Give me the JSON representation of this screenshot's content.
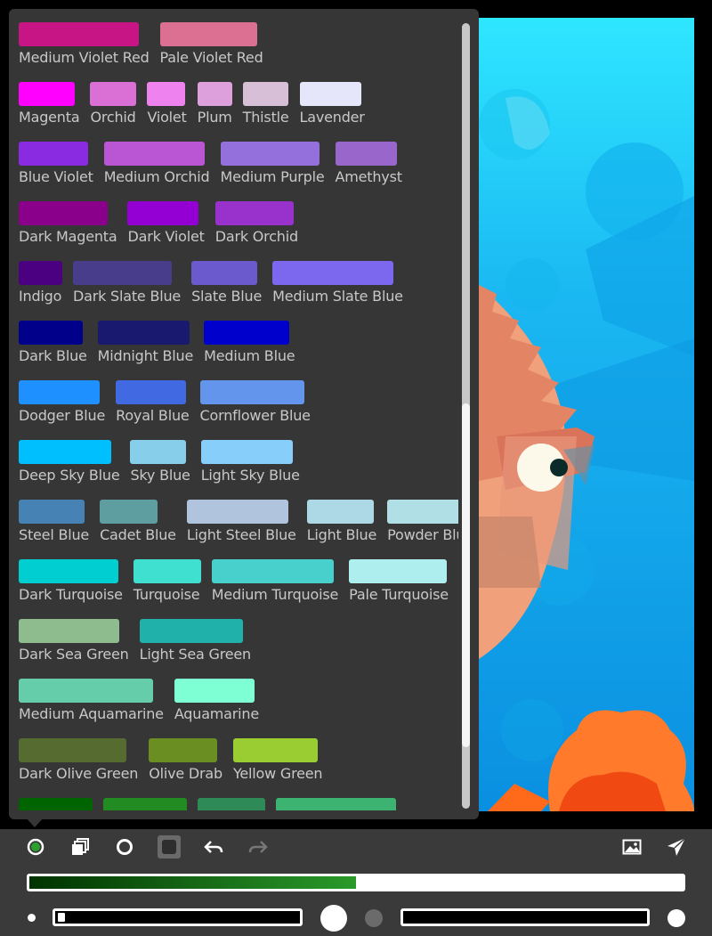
{
  "swatch_rows": [
    [
      {
        "label": "Medium Violet Red",
        "color": "#c71585"
      },
      {
        "label": "Pale Violet Red",
        "color": "#db7093"
      }
    ],
    [
      {
        "label": "Magenta",
        "color": "#ff00ff"
      },
      {
        "label": "Orchid",
        "color": "#da70d6"
      },
      {
        "label": "Violet",
        "color": "#ee82ee"
      },
      {
        "label": "Plum",
        "color": "#dda0dd"
      },
      {
        "label": "Thistle",
        "color": "#d8bfd8"
      },
      {
        "label": "Lavender",
        "color": "#e6e6fa"
      }
    ],
    [
      {
        "label": "Blue Violet",
        "color": "#8a2be2"
      },
      {
        "label": "Medium Orchid",
        "color": "#ba55d3"
      },
      {
        "label": "Medium Purple",
        "color": "#9370db"
      },
      {
        "label": "Amethyst",
        "color": "#9966cc"
      }
    ],
    [
      {
        "label": "Dark Magenta",
        "color": "#8b008b"
      },
      {
        "label": "Dark Violet",
        "color": "#9400d3"
      },
      {
        "label": "Dark Orchid",
        "color": "#9932cc"
      }
    ],
    [
      {
        "label": "Indigo",
        "color": "#4b0082"
      },
      {
        "label": "Dark Slate Blue",
        "color": "#483d8b"
      },
      {
        "label": "Slate Blue",
        "color": "#6a5acd"
      },
      {
        "label": "Medium Slate Blue",
        "color": "#7b68ee"
      }
    ],
    [
      {
        "label": "Dark Blue",
        "color": "#00008b"
      },
      {
        "label": "Midnight Blue",
        "color": "#191970"
      },
      {
        "label": "Medium Blue",
        "color": "#0000cd"
      }
    ],
    [
      {
        "label": "Dodger Blue",
        "color": "#1e90ff"
      },
      {
        "label": "Royal Blue",
        "color": "#4169e1"
      },
      {
        "label": "Cornflower Blue",
        "color": "#6495ed"
      }
    ],
    [
      {
        "label": "Deep Sky Blue",
        "color": "#00bfff"
      },
      {
        "label": "Sky Blue",
        "color": "#87ceeb"
      },
      {
        "label": "Light Sky Blue",
        "color": "#87cefa"
      }
    ],
    [
      {
        "label": "Steel Blue",
        "color": "#4682b4"
      },
      {
        "label": "Cadet Blue",
        "color": "#5f9ea0"
      },
      {
        "label": "Light Steel Blue",
        "color": "#b0c4de"
      },
      {
        "label": "Light Blue",
        "color": "#add8e6"
      },
      {
        "label": "Powder Blue",
        "color": "#b0e0e6"
      }
    ],
    [
      {
        "label": "Dark Turquoise",
        "color": "#00ced1"
      },
      {
        "label": "Turquoise",
        "color": "#40e0d0"
      },
      {
        "label": "Medium Turquoise",
        "color": "#48d1cc"
      },
      {
        "label": "Pale Turquoise",
        "color": "#afeeee"
      }
    ],
    [
      {
        "label": "Dark Sea Green",
        "color": "#8fbc8f"
      },
      {
        "label": "Light Sea Green",
        "color": "#20b2aa"
      }
    ],
    [
      {
        "label": "Medium Aquamarine",
        "color": "#66cdaa"
      },
      {
        "label": "Aquamarine",
        "color": "#7fffd4"
      }
    ],
    [
      {
        "label": "Dark Olive Green",
        "color": "#556b2f"
      },
      {
        "label": "Olive Drab",
        "color": "#6b8e23"
      },
      {
        "label": "Yellow Green",
        "color": "#9acd32"
      }
    ],
    [
      {
        "label": "",
        "color": "#006400"
      },
      {
        "label": "",
        "color": "#228b22"
      },
      {
        "label": "",
        "color": "#2e8b57"
      },
      {
        "label": "",
        "color": "#3cb371"
      }
    ]
  ],
  "toolbar": {
    "current_color": "#2ca02c",
    "icons": [
      "brush-dot-icon",
      "layers-icon",
      "circle-outline-icon",
      "square-stop-icon",
      "undo-icon",
      "redo-icon",
      "image-icon",
      "send-icon"
    ]
  },
  "color_slider": {
    "fill_fraction": 0.5
  },
  "size_slider": {
    "fraction": 0.01
  },
  "opacity_slider": {
    "fraction": 0.0
  }
}
